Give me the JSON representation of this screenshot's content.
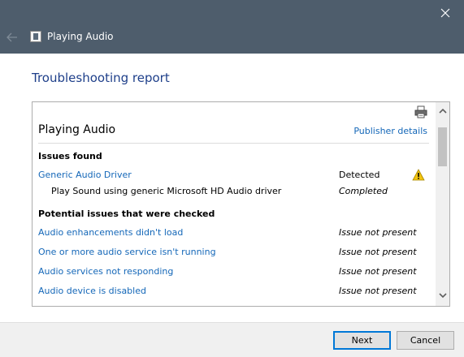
{
  "window": {
    "title": "Playing Audio"
  },
  "heading": "Troubleshooting report",
  "report": {
    "title": "Playing Audio",
    "publisher_link": "Publisher details",
    "issues_found": {
      "title": "Issues found",
      "items": [
        {
          "label": "Generic Audio Driver",
          "status": "Detected",
          "sub_label": "Play Sound using generic Microsoft HD Audio driver",
          "sub_status": "Completed"
        }
      ]
    },
    "potential_issues": {
      "title": "Potential issues that were checked",
      "items": [
        {
          "label": "Audio enhancements didn't load",
          "status": "Issue not present"
        },
        {
          "label": "One or more audio service isn't running",
          "status": "Issue not present"
        },
        {
          "label": "Audio services not responding",
          "status": "Issue not present"
        },
        {
          "label": "Audio device is disabled",
          "status": "Issue not present"
        }
      ]
    }
  },
  "footer": {
    "next_label": "Next",
    "cancel_label": "Cancel"
  },
  "colors": {
    "titlebar": "#4e5d6c",
    "heading": "#1e3f8a",
    "link": "#1467b8",
    "button_focus": "#0078d7",
    "warning": "#f2c40f"
  },
  "icons": {
    "close": "close-icon",
    "back": "back-arrow-icon",
    "app": "troubleshooter-icon",
    "print": "printer-icon",
    "warning": "warning-icon",
    "scroll_up": "chevron-up-icon",
    "scroll_down": "chevron-down-icon"
  }
}
